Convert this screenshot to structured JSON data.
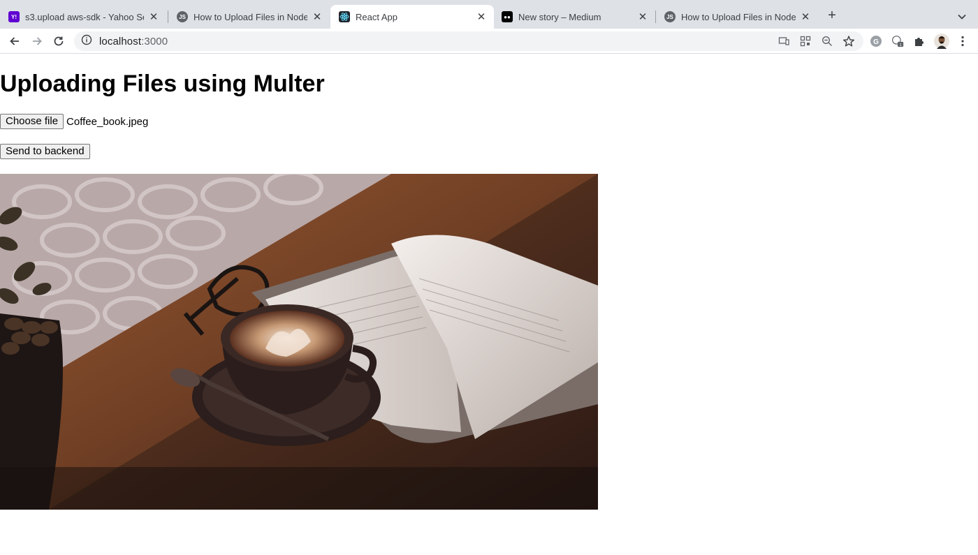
{
  "browser": {
    "tabs": [
      {
        "title": "s3.upload aws-sdk - Yahoo Se",
        "favicon": "yahoo-favicon",
        "active": false
      },
      {
        "title": "How to Upload Files in Node.js",
        "favicon": "js-favicon",
        "active": false
      },
      {
        "title": "React App",
        "favicon": "react-favicon",
        "active": true
      },
      {
        "title": "New story – Medium",
        "favicon": "medium-favicon",
        "active": false
      },
      {
        "title": "How to Upload Files in Node.js",
        "favicon": "js-favicon",
        "active": false
      }
    ],
    "new_tab_label": "+",
    "address": {
      "host": "localhost",
      "port": ":3000"
    }
  },
  "page": {
    "heading": "Uploading Files using Multer",
    "choose_file_label": "Choose file",
    "selected_file": "Coffee_book.jpeg",
    "send_button_label": "Send to backend"
  },
  "colors": {
    "tabstrip": "#dee1e6",
    "omnibox": "#f1f3f4",
    "avatar": "#3d2b1f"
  }
}
